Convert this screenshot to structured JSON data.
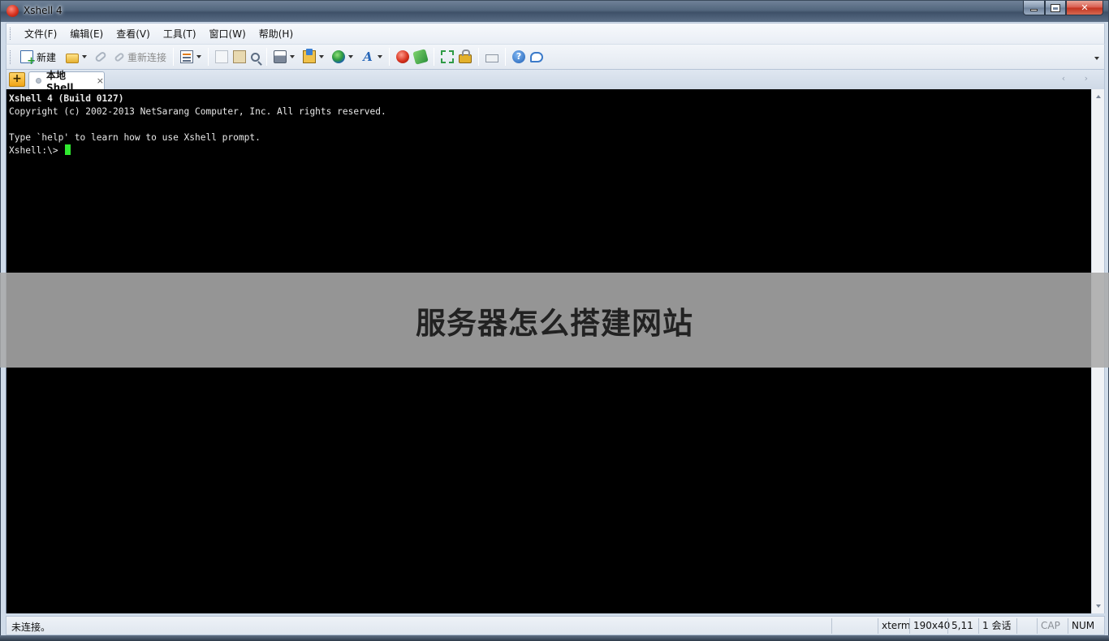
{
  "window": {
    "title": "Xshell 4"
  },
  "menu": [
    "文件(F)",
    "编辑(E)",
    "查看(V)",
    "工具(T)",
    "窗口(W)",
    "帮助(H)"
  ],
  "toolbar": {
    "new_label": "新建",
    "reconnect_label": "重新连接"
  },
  "tabs": [
    {
      "label": "本地Shell",
      "close": "×"
    }
  ],
  "tab_nav": "‹ ›",
  "terminal": {
    "lines": [
      "Xshell 4 (Build 0127)",
      "Copyright (c) 2002-2013 NetSarang Computer, Inc. All rights reserved.",
      "",
      "Type `help' to learn how to use Xshell prompt.",
      "Xshell:\\> "
    ],
    "cursor_color": "#2fe82f"
  },
  "banner": {
    "text": "服务器怎么搭建网站"
  },
  "status": {
    "message": "未连接。",
    "terminal_type": "xterm",
    "size": "190x40",
    "position": "5,11",
    "sessions": "1 会话",
    "cap": "CAP",
    "num": "NUM"
  }
}
